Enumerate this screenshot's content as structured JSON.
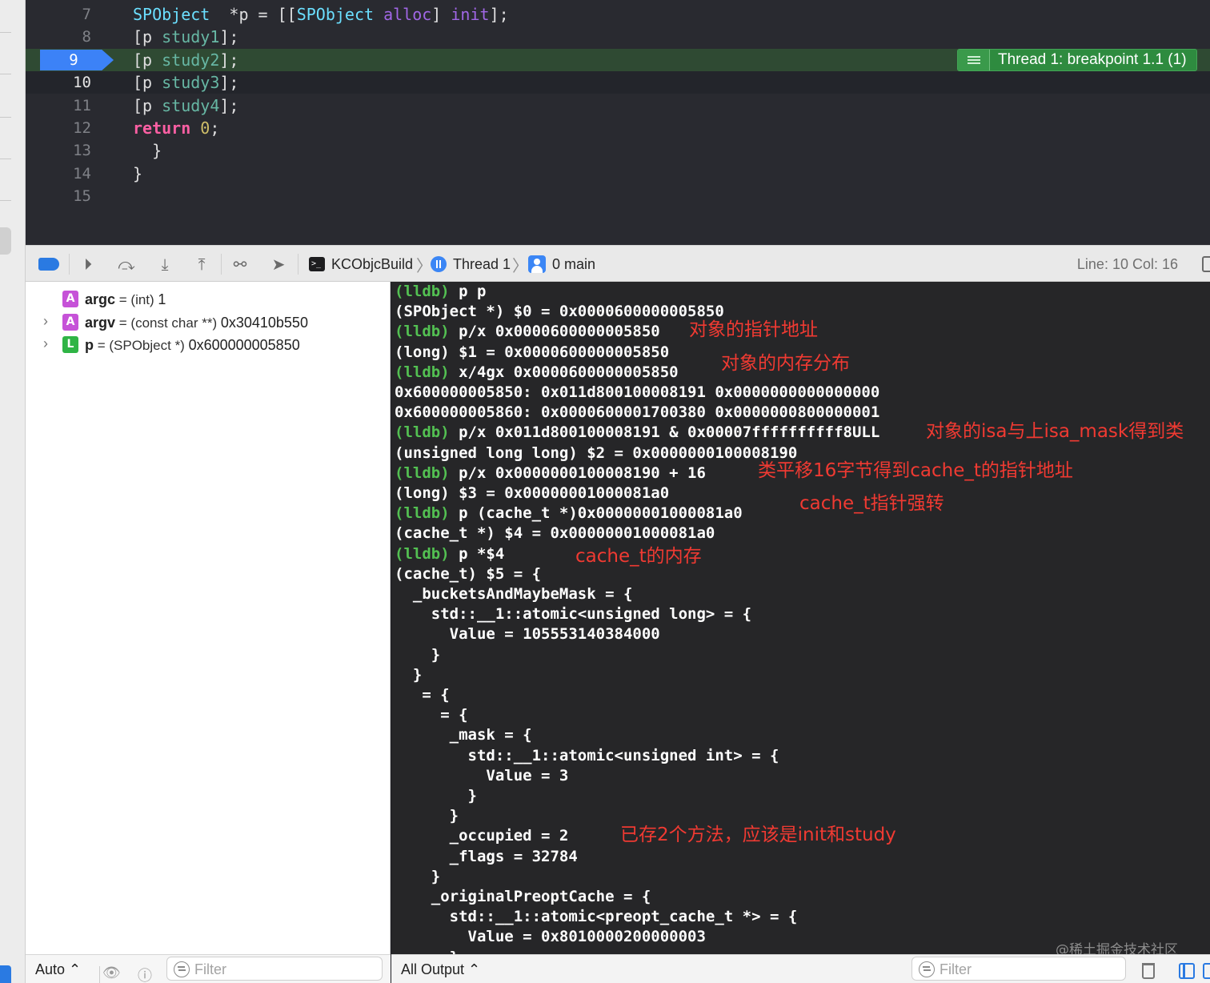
{
  "editor": {
    "lines": [
      {
        "n": "7",
        "tokens": [
          [
            "ty",
            "SPObject"
          ],
          [
            "",
            "  *p = [["
          ],
          [
            "ty",
            "SPObject"
          ],
          [
            "",
            " "
          ],
          [
            "me",
            "alloc"
          ],
          [
            "",
            "] "
          ],
          [
            "me",
            "init"
          ],
          [
            "",
            "];"
          ]
        ]
      },
      {
        "n": "8",
        "tokens": [
          [
            "",
            "[p "
          ],
          [
            "fn",
            "study1"
          ],
          [
            "",
            "];"
          ]
        ]
      },
      {
        "n": "9",
        "tokens": [
          [
            "",
            "[p "
          ],
          [
            "fn",
            "study2"
          ],
          [
            "",
            "];"
          ]
        ]
      },
      {
        "n": "10",
        "tokens": [
          [
            "",
            "[p "
          ],
          [
            "fn",
            "study3"
          ],
          [
            "",
            "];"
          ]
        ]
      },
      {
        "n": "11",
        "tokens": [
          [
            "",
            "[p "
          ],
          [
            "fn",
            "study4"
          ],
          [
            "",
            "];"
          ]
        ]
      },
      {
        "n": "12",
        "tokens": [
          [
            "kw",
            "return"
          ],
          [
            "",
            " "
          ],
          [
            "num",
            "0"
          ],
          [
            "",
            ";"
          ]
        ]
      },
      {
        "n": "13",
        "tokens": [
          [
            "",
            "  }"
          ]
        ]
      },
      {
        "n": "14",
        "tokens": [
          [
            "",
            "}"
          ]
        ]
      },
      {
        "n": "15",
        "tokens": []
      }
    ],
    "breakpoint_line": "9",
    "thread_badge": "Thread 1: breakpoint 1.1 (1)"
  },
  "debug_bar": {
    "target": "KCObjcBuild",
    "thread": "Thread 1",
    "frame": "0 main",
    "line_col": "Line: 10  Col: 16"
  },
  "variables": [
    {
      "badge": "A",
      "kind": "arg",
      "name": "argc",
      "eq": " = ",
      "type": "(int) ",
      "value": "1",
      "expandable": false
    },
    {
      "badge": "A",
      "kind": "arg",
      "name": "argv",
      "eq": " = ",
      "type": "(const char **) ",
      "value": "0x30410b550",
      "expandable": true
    },
    {
      "badge": "L",
      "kind": "loc",
      "name": "p",
      "eq": " = ",
      "type": "(SPObject *) ",
      "value": "0x600000005850",
      "expandable": true
    }
  ],
  "variables_footer": {
    "scope": "Auto ⌃",
    "filter_placeholder": "Filter"
  },
  "console": {
    "lines": [
      {
        "prompt": "(lldb)",
        "text": " p p"
      },
      {
        "prompt": "",
        "text": "(SPObject *) $0 = 0x0000600000005850"
      },
      {
        "prompt": "(lldb)",
        "text": " p/x 0x0000600000005850"
      },
      {
        "prompt": "",
        "text": "(long) $1 = 0x0000600000005850"
      },
      {
        "prompt": "(lldb)",
        "text": " x/4gx 0x0000600000005850"
      },
      {
        "prompt": "",
        "text": "0x600000005850: 0x011d800100008191 0x0000000000000000"
      },
      {
        "prompt": "",
        "text": "0x600000005860: 0x0000600001700380 0x0000000800000001"
      },
      {
        "prompt": "(lldb)",
        "text": " p/x 0x011d800100008191 & 0x00007ffffffffff8ULL"
      },
      {
        "prompt": "",
        "text": "(unsigned long long) $2 = 0x0000000100008190"
      },
      {
        "prompt": "(lldb)",
        "text": " p/x 0x0000000100008190 + 16"
      },
      {
        "prompt": "",
        "text": "(long) $3 = 0x00000001000081a0"
      },
      {
        "prompt": "(lldb)",
        "text": " p (cache_t *)0x00000001000081a0"
      },
      {
        "prompt": "",
        "text": "(cache_t *) $4 = 0x00000001000081a0"
      },
      {
        "prompt": "(lldb)",
        "text": " p *$4"
      },
      {
        "prompt": "",
        "text": "(cache_t) $5 = {"
      },
      {
        "prompt": "",
        "text": "  _bucketsAndMaybeMask = {"
      },
      {
        "prompt": "",
        "text": "    std::__1::atomic<unsigned long> = {"
      },
      {
        "prompt": "",
        "text": "      Value = 105553140384000"
      },
      {
        "prompt": "",
        "text": "    }"
      },
      {
        "prompt": "",
        "text": "  }"
      },
      {
        "prompt": "",
        "text": "   = {"
      },
      {
        "prompt": "",
        "text": "     = {"
      },
      {
        "prompt": "",
        "text": "      _mask = {"
      },
      {
        "prompt": "",
        "text": "        std::__1::atomic<unsigned int> = {"
      },
      {
        "prompt": "",
        "text": "          Value = 3"
      },
      {
        "prompt": "",
        "text": "        }"
      },
      {
        "prompt": "",
        "text": "      }"
      },
      {
        "prompt": "",
        "text": "      _occupied = 2"
      },
      {
        "prompt": "",
        "text": "      _flags = 32784"
      },
      {
        "prompt": "",
        "text": "    }"
      },
      {
        "prompt": "",
        "text": "    _originalPreoptCache = {"
      },
      {
        "prompt": "",
        "text": "      std::__1::atomic<preopt_cache_t *> = {"
      },
      {
        "prompt": "",
        "text": "        Value = 0x8010000200000003"
      },
      {
        "prompt": "",
        "text": "      }"
      }
    ],
    "annotations": [
      "对象的指针地址",
      "对象的内存分布",
      "对象的isa与上isa_mask得到类",
      "类平移16字节得到cache_t的指针地址",
      "cache_t指针强转",
      "cache_t的内存",
      "已存2个方法，应该是init和study"
    ],
    "watermark": "@稀土掘金技术社区",
    "output_selector": "All Output ⌃",
    "filter_placeholder": "Filter"
  }
}
